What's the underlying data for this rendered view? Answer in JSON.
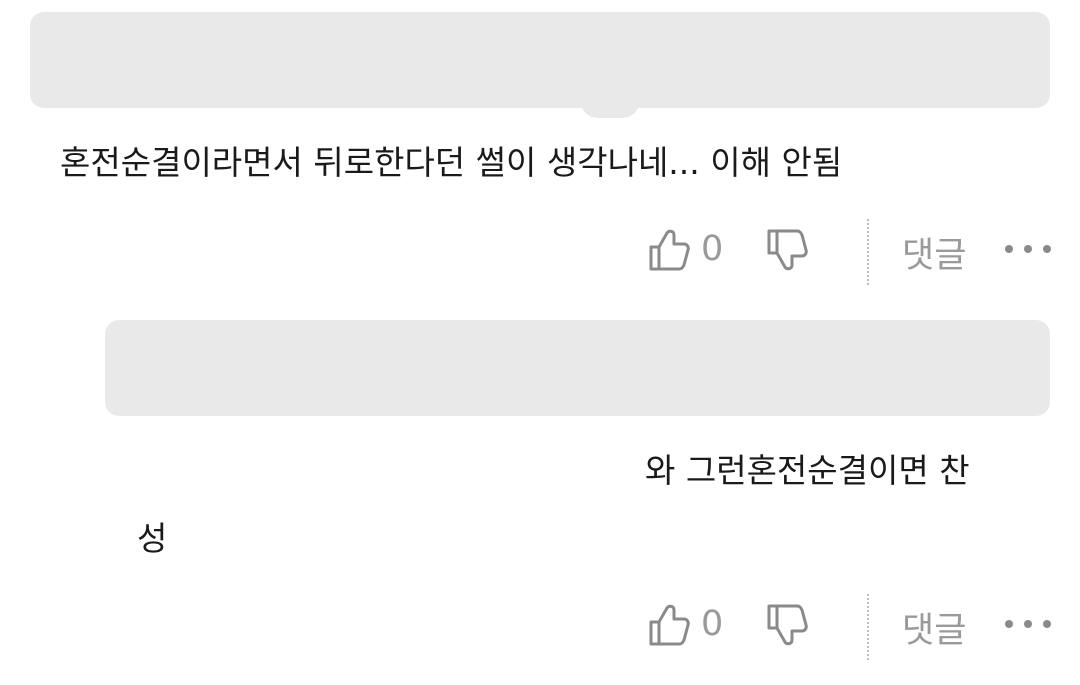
{
  "comments": [
    {
      "text": "혼전순결이라면서 뒤로한다던 썰이 생각나네... 이해 안됨",
      "like_count": "0",
      "reply_label": "댓글"
    },
    {
      "text_line1": "와 그런혼전순결이면 찬",
      "text_line2": "성",
      "like_count": "0",
      "reply_label": "댓글"
    }
  ],
  "icons": {
    "like": "thumbs-up-icon",
    "dislike": "thumbs-down-icon",
    "more": "more-horizontal-icon"
  },
  "colors": {
    "placeholder_bar": "#e9e9e9",
    "muted_text": "#9a9a9a",
    "body_text": "#1a1a1a"
  }
}
